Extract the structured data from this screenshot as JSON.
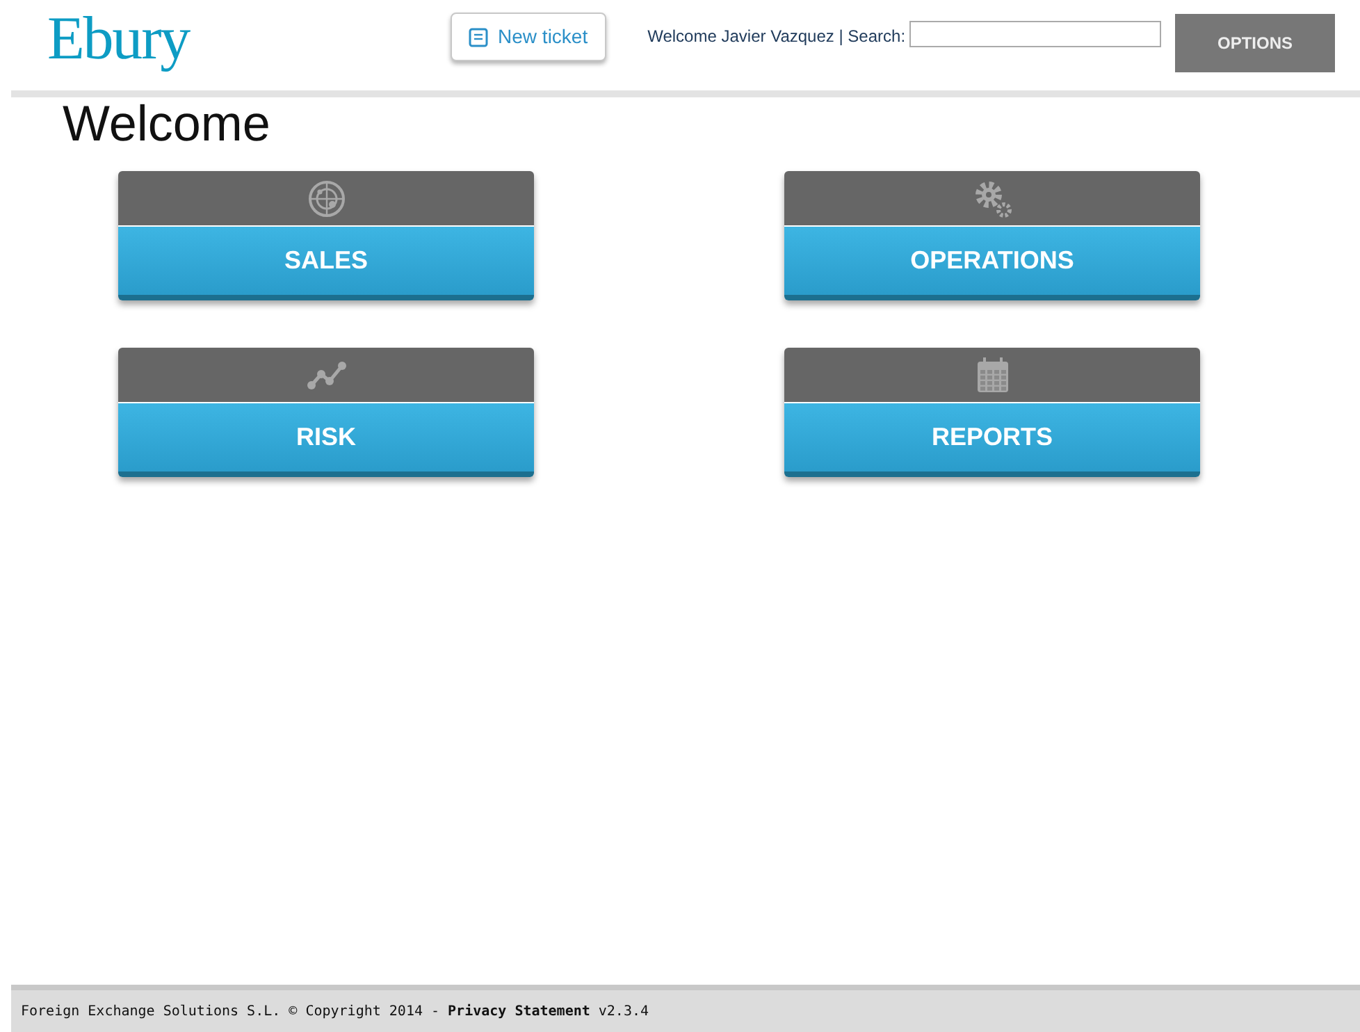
{
  "header": {
    "logo": "Ebury",
    "new_ticket": "New ticket",
    "welcome": "Welcome Javier Vazquez | Search:",
    "options": "OPTIONS"
  },
  "page_title": "Welcome",
  "tiles": [
    {
      "kind": "radar",
      "label": "SALES"
    },
    {
      "kind": "gears",
      "label": "OPERATIONS"
    },
    {
      "kind": "chart",
      "label": "RISK"
    },
    {
      "kind": "calendar",
      "label": "REPORTS"
    }
  ],
  "footer": {
    "copyright": "Foreign Exchange Solutions S.L. © Copyright 2014 -",
    "link": "Privacy Statement",
    "version": "v2.3.4"
  }
}
